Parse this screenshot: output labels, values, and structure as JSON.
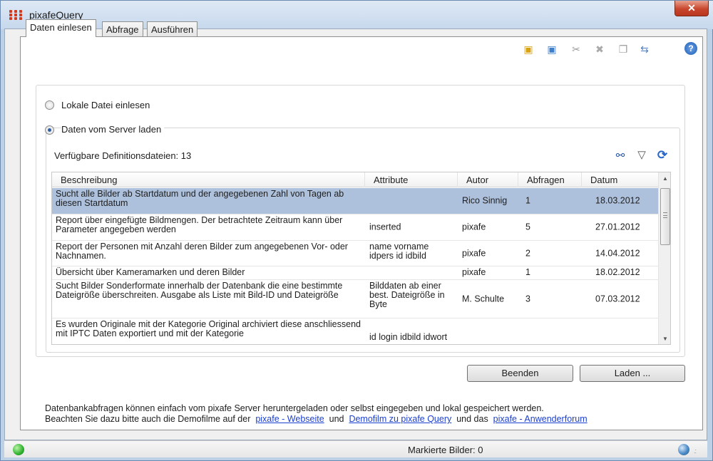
{
  "window": {
    "title": "pixafeQuery",
    "close_glyph": "✕"
  },
  "tabs": [
    {
      "label": "Daten einlesen",
      "active": true
    },
    {
      "label": "Abfrage",
      "active": false
    },
    {
      "label": "Ausführen",
      "active": false
    }
  ],
  "toolbar": {
    "icons": [
      "new-query-icon",
      "import-icon",
      "tools-icon",
      "delete-icon",
      "copy-icon",
      "export-icon"
    ],
    "help_glyph": "?"
  },
  "source": {
    "local_label": "Lokale Datei einlesen",
    "server_label": "Daten vom Server laden",
    "selected": "server"
  },
  "definitions": {
    "count_label": "Verfügbare Definitionsdateien: 13"
  },
  "grid": {
    "columns": [
      "Beschreibung",
      "Attribute",
      "Autor",
      "Abfragen",
      "Datum"
    ],
    "rows": [
      {
        "desc": "Sucht alle Bilder ab Startdatum und der angegebenen Zahl von Tagen ab diesen Startdatum",
        "attr": "",
        "author": "Rico Sinnig",
        "count": "1",
        "date": "18.03.2012",
        "selected": true
      },
      {
        "desc": "Report über eingefügte Bildmengen. Der betrachtete Zeitraum kann über Parameter angegeben werden",
        "attr": "inserted",
        "author": "pixafe",
        "count": "5",
        "date": "27.01.2012"
      },
      {
        "desc": "Report der Personen mit Anzahl deren Bilder zum angegebenen Vor- oder Nachnamen.",
        "attr": "name vorname idpers id idbild",
        "author": "pixafe",
        "count": "2",
        "date": "14.04.2012"
      },
      {
        "desc": "Übersicht über Kameramarken und deren Bilder",
        "attr": "",
        "author": "pixafe",
        "count": "1",
        "date": "18.02.2012"
      },
      {
        "desc": "Sucht Bilder Sonderformate innerhalb der Datenbank die eine bestimmte Dateigröße überschreiten. Ausgabe als Liste mit Bild-ID und Dateigröße",
        "attr": "Bilddaten ab einer best. Dateigröße in Byte",
        "author": "M. Schulte",
        "count": "3",
        "date": "07.03.2012"
      },
      {
        "desc": "Es wurden Originale mit der Kategorie Original archiviert diese anschliessend mit IPTC Daten exportiert und mit der Kategorie",
        "attr": "id login idbild idwort",
        "author": "",
        "count": "",
        "date": ""
      }
    ]
  },
  "buttons": {
    "quit": "Beenden",
    "load": "Laden ..."
  },
  "info": {
    "line1": "Datenbankabfragen können einfach vom pixafe Server heruntergeladen oder selbst eingegeben und lokal gespeichert werden.",
    "line2_prefix": "Beachten Sie dazu bitte auch die Demofilme auf der",
    "link_website": "pixafe - Webseite",
    "and1": "und",
    "link_demofilm": "Demofilm zu pixafe Query",
    "and2": "und das",
    "link_forum": "pixafe - Anwenderforum"
  },
  "status": {
    "marked_images": "Markierte Bilder: 0",
    "led_color": "#2fb12f"
  }
}
